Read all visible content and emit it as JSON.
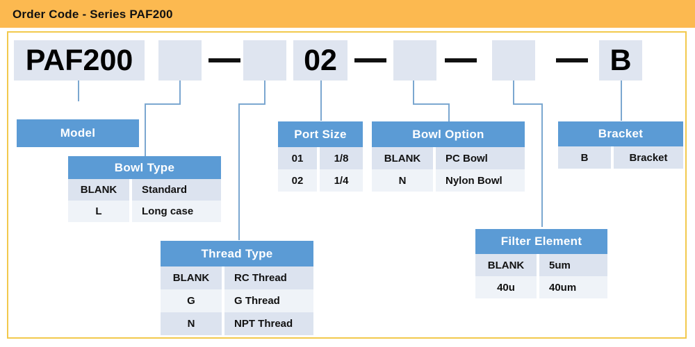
{
  "header": {
    "title": "Order Code - Series PAF200",
    "bar_color": "#FCB950",
    "frame_color": "#F2C94C"
  },
  "theme": {
    "head_blue": "#5B9BD5",
    "code_box_fill": "#DFE5F0",
    "row_odd": "#DCE3EF",
    "row_even": "#EFF3F8",
    "connector": "#7BA7D0"
  },
  "order_code": {
    "segments": [
      {
        "value": "PAF200",
        "kind": "box",
        "name": "model"
      },
      {
        "value": "",
        "kind": "box",
        "name": "bowl-type"
      },
      {
        "value": "—",
        "kind": "dash",
        "name": "dash-1"
      },
      {
        "value": "",
        "kind": "box",
        "name": "thread-type"
      },
      {
        "value": "02",
        "kind": "box",
        "name": "port-size"
      },
      {
        "value": "—",
        "kind": "dash",
        "name": "dash-2"
      },
      {
        "value": "",
        "kind": "box",
        "name": "bowl-option"
      },
      {
        "value": "—",
        "kind": "dash",
        "name": "dash-3"
      },
      {
        "value": "",
        "kind": "box",
        "name": "filter-element"
      },
      {
        "value": "—",
        "kind": "dash",
        "name": "dash-4"
      },
      {
        "value": "B",
        "kind": "box",
        "name": "bracket"
      }
    ]
  },
  "tables": {
    "model": {
      "title": "Model",
      "rows": []
    },
    "bowl_type": {
      "title": "Bowl Type",
      "rows": [
        {
          "code": "BLANK",
          "desc": "Standard"
        },
        {
          "code": "L",
          "desc": "Long case"
        }
      ]
    },
    "thread_type": {
      "title": "Thread Type",
      "rows": [
        {
          "code": "BLANK",
          "desc": "RC Thread"
        },
        {
          "code": "G",
          "desc": "G Thread"
        },
        {
          "code": "N",
          "desc": "NPT Thread"
        }
      ]
    },
    "port_size": {
      "title": "Port Size",
      "rows": [
        {
          "code": "01",
          "desc": "1/8"
        },
        {
          "code": "02",
          "desc": "1/4"
        }
      ]
    },
    "bowl_option": {
      "title": "Bowl Option",
      "rows": [
        {
          "code": "BLANK",
          "desc": "PC Bowl"
        },
        {
          "code": "N",
          "desc": "Nylon Bowl"
        }
      ]
    },
    "filter_element": {
      "title": "Filter Element",
      "rows": [
        {
          "code": "BLANK",
          "desc": "5um"
        },
        {
          "code": "40u",
          "desc": "40um"
        }
      ]
    },
    "bracket": {
      "title": "Bracket",
      "rows": [
        {
          "code": "B",
          "desc": "Bracket"
        }
      ]
    }
  }
}
